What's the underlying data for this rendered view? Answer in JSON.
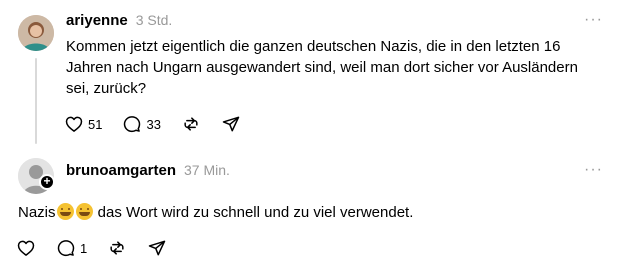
{
  "posts": [
    {
      "username": "ariyenne",
      "time": "3 Std.",
      "text": "Kommen jetzt eigentlich die ganzen deutschen Nazis, die in den letzten 16 Jahren nach Ungarn ausgewandert sind, weil man dort sicher vor Ausländern sei, zurück?",
      "likes": "51",
      "replies": "33",
      "more": "···"
    },
    {
      "username": "brunoamgarten",
      "time": "37 Min.",
      "text_before": "Nazis",
      "text_after": " das Wort wird zu schnell und zu viel verwendet.",
      "emoji": [
        "rolling-on-floor-laughing",
        "rolling-on-floor-laughing"
      ],
      "replies": "1",
      "more": "···",
      "badge": "+"
    }
  ],
  "icons": {
    "like": "heart-icon",
    "reply": "comment-icon",
    "repost": "repost-icon",
    "share": "send-icon"
  }
}
